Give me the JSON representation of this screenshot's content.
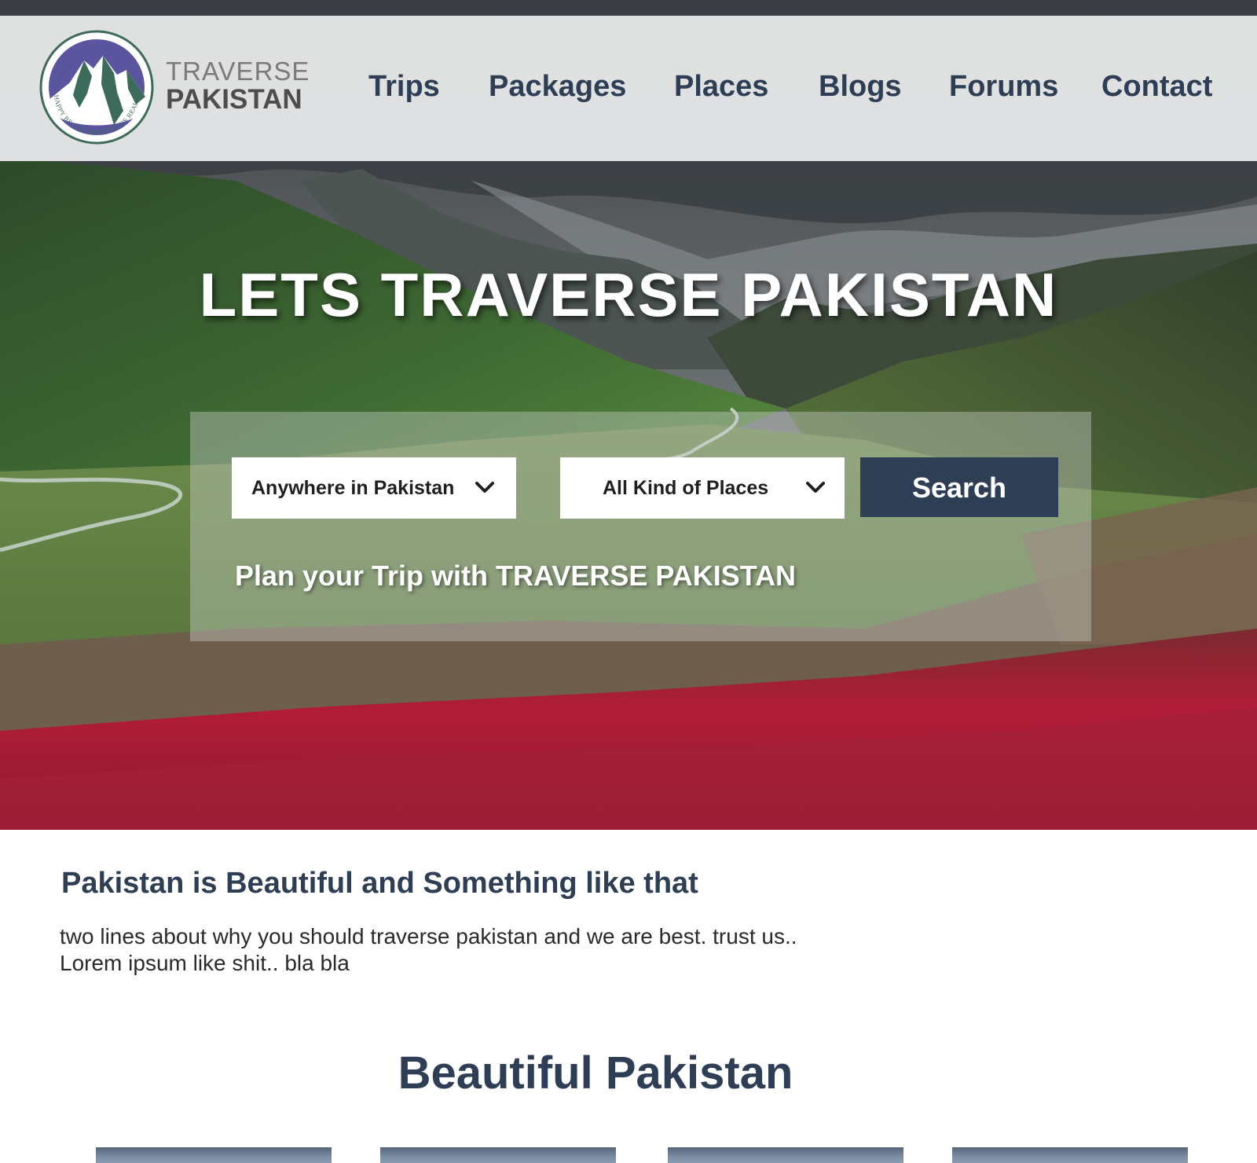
{
  "brand": {
    "name_line1": "TRAVERSE",
    "name_line2": "PAKISTAN",
    "motto": "HAPPY BE THE BOUNTEOUS REALM"
  },
  "nav": {
    "items": [
      {
        "label": "Trips"
      },
      {
        "label": "Packages"
      },
      {
        "label": "Places"
      },
      {
        "label": "Blogs"
      },
      {
        "label": "Forums"
      },
      {
        "label": "Contact"
      }
    ]
  },
  "hero": {
    "headline": "LETS TRAVERSE PAKISTAN"
  },
  "search": {
    "location_select": "Anywhere in Pakistan",
    "place_type_select": "All Kind of Places",
    "button_label": "Search",
    "tagline": "Plan your Trip with TRAVERSE PAKISTAN"
  },
  "intro": {
    "title": "Pakistan is Beautiful and Something like that",
    "text_line1": "two lines about why you should traverse pakistan and we are best. trust us..",
    "text_line2": "Lorem ipsum like shit.. bla bla"
  },
  "gallery": {
    "title": "Beautiful Pakistan",
    "count": 4
  },
  "colors": {
    "primary_navy": "#2d3e55",
    "logo_purple": "#5b55a0",
    "logo_green": "#3c6b5a",
    "header_bg": "#ecedee",
    "white": "#ffffff"
  }
}
